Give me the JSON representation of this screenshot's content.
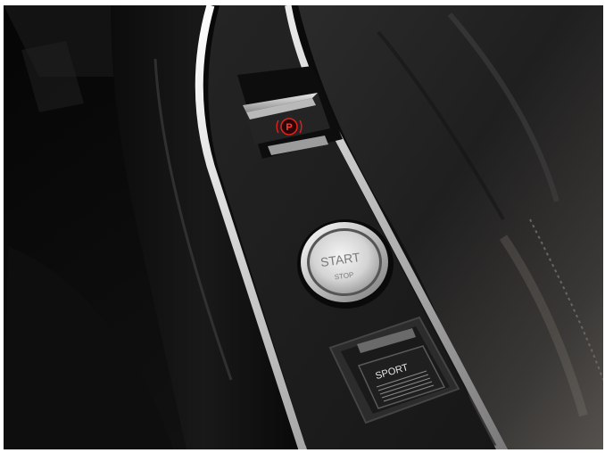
{
  "photo": {
    "subject": "Car center console with electronic parking brake, start/stop button and sport mode switch",
    "parking_brake": {
      "glyph": "P",
      "indicator_color": "#e0201c"
    },
    "start_button": {
      "label_primary": "START",
      "label_secondary": "STOP"
    },
    "sport_switch": {
      "label": "SPORT"
    },
    "colors": {
      "background": "#0b0b0b",
      "console_panel": "#1b1b1c",
      "chrome_trim": "#d9d9d9",
      "leather_boot": "#2a2a2a"
    }
  }
}
